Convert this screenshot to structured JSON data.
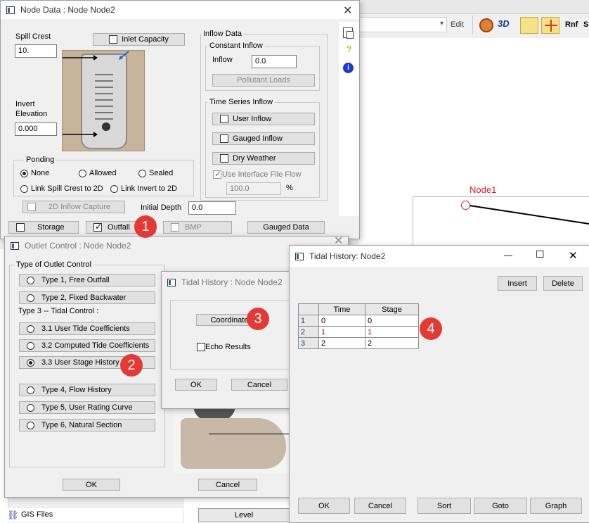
{
  "background": {
    "toolbar": {
      "dropdown_arrow": "▾",
      "edit_label": "Edit",
      "rnf_label": "Rnf",
      "s_label": "S"
    },
    "canvas": {
      "node_label": "Node1"
    },
    "sidebar": {
      "gis_label": "GIS Files"
    },
    "level_header": "Level"
  },
  "node_data": {
    "title": "Node Data : Node Node2",
    "spill_crest_label": "Spill Crest",
    "spill_crest_value": "10.",
    "inlet_capacity_label": "Inlet Capacity",
    "invert_elevation_label_1": "Invert",
    "invert_elevation_label_2": "Elevation",
    "invert_elevation_value": "0.000",
    "inflow_data_label": "Inflow Data",
    "constant_inflow_label": "Constant Inflow",
    "inflow_label": "Inflow",
    "inflow_value": "0.0",
    "pollutant_loads_label": "Pollutant Loads",
    "time_series_label": "Time Series Inflow",
    "user_inflow_label": "User Inflow",
    "gauged_inflow_label": "Gauged Inflow",
    "dry_weather_label": "Dry Weather",
    "use_interface_label": "Use Interface File Flow",
    "interface_value": "100.0",
    "percent_label": "%",
    "ponding_label": "Ponding",
    "none_label": "None",
    "allowed_label": "Allowed",
    "sealed_label": "Sealed",
    "link_spill_label": "Link Spill Crest to 2D",
    "link_invert_label": "Link Invert to 2D",
    "inflow_capture_label": "2D Inflow Capture",
    "initial_depth_label": "Initial Depth",
    "initial_depth_value": "0.0",
    "storage_label": "Storage",
    "outfall_label": "Outfall",
    "bmp_label": "BMP",
    "gauged_data_label": "Gauged Data",
    "help_icon_glyph": "?",
    "info_icon_glyph": "i"
  },
  "outlet_control": {
    "title": "Outlet Control : Node Node2",
    "type_group_label": "Type of Outlet Control",
    "type1_label": "Type 1, Free Outfall",
    "type2_label": "Type 2, Fixed Backwater",
    "type3_heading": "Type 3 -- Tidal Control :",
    "type31_label": "3.1 User Tide Coefficients",
    "type32_label": "3.2 Computed Tide Coefficients",
    "type33_label": "3.3 User Stage History",
    "type4_label": "Type 4, Flow History",
    "type5_label": "Type 5, User Rating Curve",
    "type6_label": "Type 6, Natural Section",
    "ok_label": "OK",
    "cancel_label": "Cancel"
  },
  "tidal_small": {
    "title": "Tidal History : Node Node2",
    "coordinates_label": "Coordinate",
    "echo_label": "Echo Results",
    "ok_label": "OK",
    "cancel_label": "Cancel"
  },
  "tidal_history": {
    "title": "Tidal History: Node2",
    "minimize_glyph": "—",
    "maximize_glyph": "☐",
    "close_glyph": "✕",
    "insert_label": "Insert",
    "delete_label": "Delete",
    "columns": [
      "Time",
      "Stage"
    ],
    "rows": [
      {
        "index": "1",
        "time": "0",
        "stage": "0"
      },
      {
        "index": "2",
        "time": "1",
        "stage": "1"
      },
      {
        "index": "3",
        "time": "2",
        "stage": "2"
      }
    ],
    "ok_label": "OK",
    "cancel_label": "Cancel",
    "sort_label": "Sort",
    "goto_label": "Goto",
    "graph_label": "Graph"
  },
  "badges": [
    "1",
    "2",
    "3",
    "4"
  ],
  "colors": {
    "badge": "#e53935",
    "node_label": "#cc2222",
    "row_index_blue": "#1a3aa8",
    "stage_value_red": "#b0152a"
  }
}
